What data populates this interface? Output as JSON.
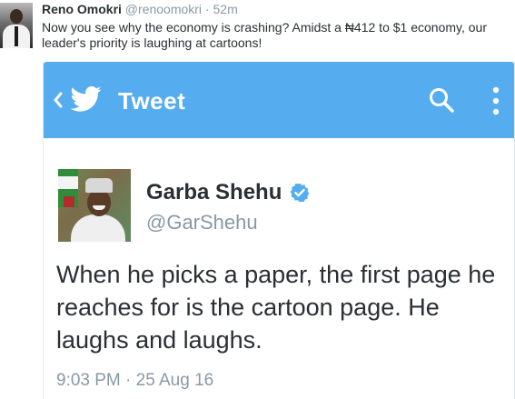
{
  "outer_tweet": {
    "name": "Reno Omokri",
    "handle": "@renoomokri",
    "separator": "·",
    "time": "52m",
    "text": "Now you see why the economy is crashing? Amidst a ₦412 to $1 economy, our leader's priority is laughing at cartoons!"
  },
  "app_bar": {
    "title": "Tweet",
    "icons": [
      "back-icon",
      "twitter-bird-icon",
      "search-icon",
      "more-icon"
    ],
    "color": "#55acee"
  },
  "inner_tweet": {
    "name": "Garba Shehu",
    "handle": "@GarShehu",
    "verified": true,
    "text": "When he picks a paper, the first page he reaches for is the cartoon page. He laughs and laughs.",
    "timestamp": "9:03 PM · 25 Aug 16"
  },
  "colors": {
    "brand_blue": "#55acee",
    "text_dark": "#292f33",
    "text_gray": "#8899a6"
  }
}
